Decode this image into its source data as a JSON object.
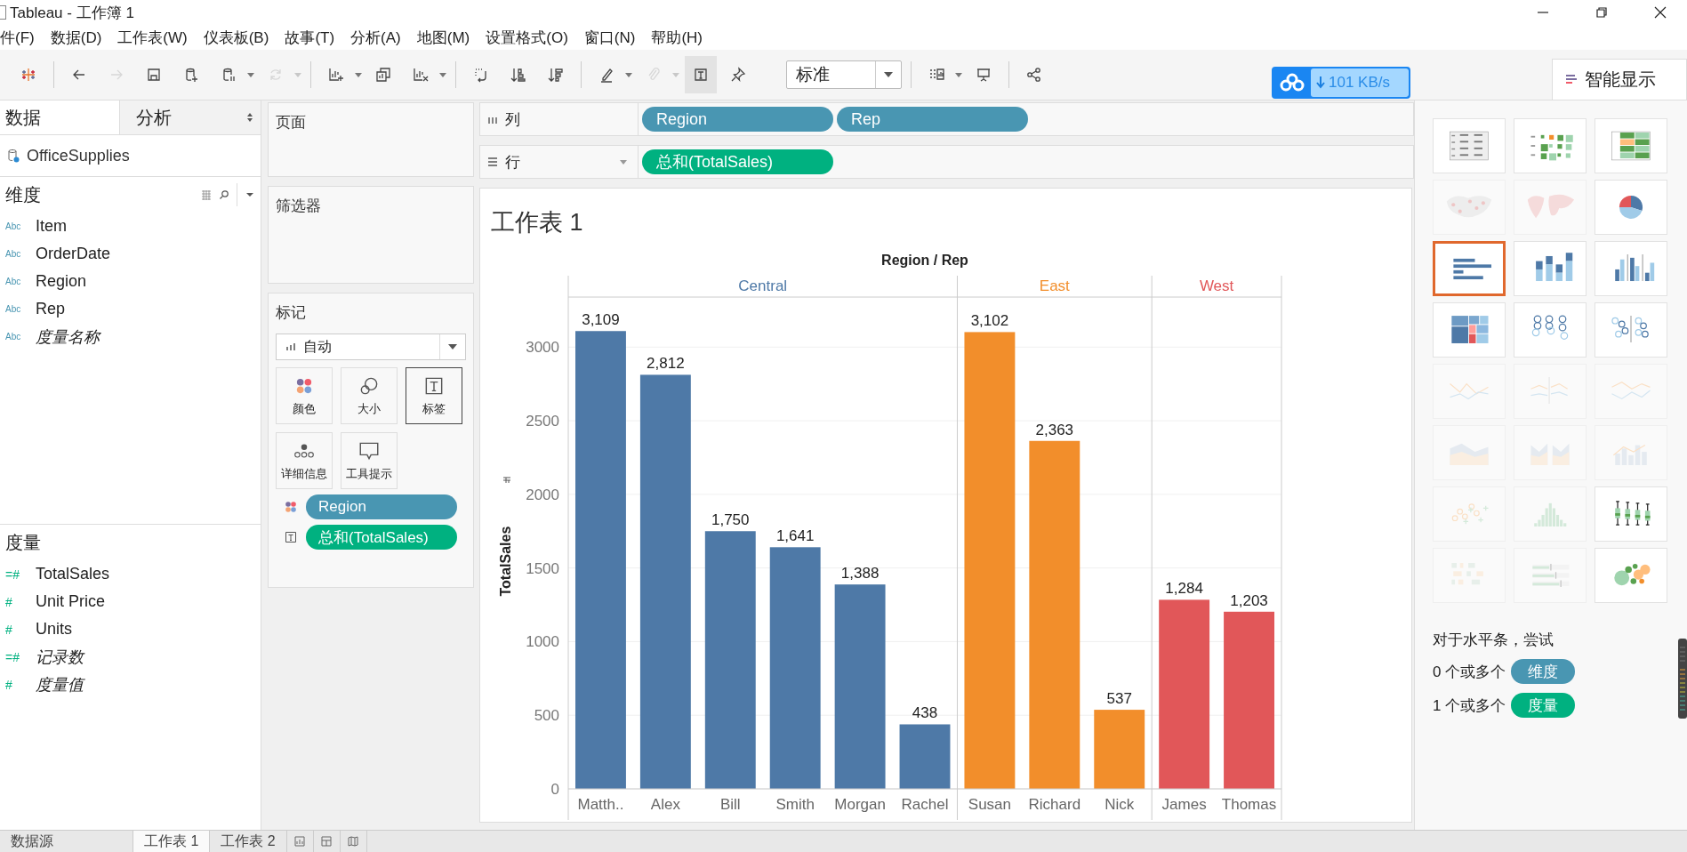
{
  "window": {
    "title": "Tableau - 工作簿 1"
  },
  "menu": [
    "件(F)",
    "数据(D)",
    "工作表(W)",
    "仪表板(B)",
    "故事(T)",
    "分析(A)",
    "地图(M)",
    "设置格式(O)",
    "窗口(N)",
    "帮助(H)"
  ],
  "toolbar": [
    [
      {
        "kind": "logo",
        "disabled": false,
        "pressed": false,
        "caret": false
      }
    ],
    [
      {
        "kind": "back",
        "disabled": false,
        "pressed": false,
        "caret": false
      },
      {
        "kind": "forward",
        "disabled": true,
        "pressed": false,
        "caret": false
      },
      {
        "kind": "save",
        "disabled": false,
        "pressed": false,
        "caret": false
      },
      {
        "kind": "add-datasource",
        "disabled": false,
        "pressed": false,
        "caret": false
      },
      {
        "kind": "pause-datasource",
        "disabled": false,
        "pressed": false,
        "caret": true
      },
      {
        "kind": "refresh",
        "disabled": true,
        "pressed": false,
        "caret": true
      }
    ],
    [
      {
        "kind": "new-sheet",
        "disabled": false,
        "pressed": false,
        "caret": true
      },
      {
        "kind": "duplicate",
        "disabled": false,
        "pressed": false,
        "caret": false
      },
      {
        "kind": "clear-sheet",
        "disabled": false,
        "pressed": false,
        "caret": true
      }
    ],
    [
      {
        "kind": "swap",
        "disabled": false,
        "pressed": false,
        "caret": false
      },
      {
        "kind": "sort-ascending",
        "disabled": false,
        "pressed": false,
        "caret": false
      },
      {
        "kind": "sort-descending",
        "disabled": false,
        "pressed": false,
        "caret": false
      }
    ],
    [
      {
        "kind": "highlight",
        "disabled": false,
        "pressed": false,
        "caret": true
      },
      {
        "kind": "paperclip",
        "disabled": true,
        "pressed": false,
        "caret": true
      },
      {
        "kind": "labels",
        "disabled": false,
        "pressed": true,
        "caret": false
      },
      {
        "kind": "pin",
        "disabled": false,
        "pressed": false,
        "caret": false
      },
      {
        "kind": "select",
        "value": "标准"
      }
    ],
    [
      {
        "kind": "cards",
        "disabled": false,
        "pressed": false,
        "caret": true
      },
      {
        "kind": "presentation",
        "disabled": false,
        "pressed": false,
        "caret": false
      }
    ],
    [
      {
        "kind": "share",
        "disabled": false,
        "pressed": false,
        "caret": false
      }
    ]
  ],
  "download_badge": {
    "speed": "101 KB/s"
  },
  "data_pane": {
    "tabs": [
      {
        "label": "数据",
        "selected": true
      },
      {
        "label": "分析",
        "selected": false
      }
    ],
    "datasource": "OfficeSupplies",
    "dimensions": {
      "title": "维度",
      "fields": [
        {
          "type": "Abc",
          "name": "Item",
          "generated": false
        },
        {
          "type": "Abc",
          "name": "OrderDate",
          "generated": false
        },
        {
          "type": "Abc",
          "name": "Region",
          "generated": false
        },
        {
          "type": "Abc",
          "name": "Rep",
          "generated": false
        },
        {
          "type": "Abc",
          "name": "度量名称",
          "generated": true
        }
      ]
    },
    "measures": {
      "title": "度量",
      "fields": [
        {
          "type": "=#",
          "name": "TotalSales",
          "generated": false
        },
        {
          "type": "#",
          "name": "Unit Price",
          "generated": false
        },
        {
          "type": "#",
          "name": "Units",
          "generated": false
        },
        {
          "type": "=#",
          "name": "记录数",
          "generated": true
        },
        {
          "type": "#",
          "name": "度量值",
          "generated": true
        }
      ]
    }
  },
  "shelves": {
    "pages": "页面",
    "filters": "筛选器",
    "marks": {
      "title": "标记",
      "mark_type": "自动",
      "cards": [
        {
          "label": "颜色",
          "kind": "color",
          "selected": false
        },
        {
          "label": "大小",
          "kind": "size",
          "selected": false
        },
        {
          "label": "标签",
          "kind": "label",
          "selected": true
        },
        {
          "label": "详细信息",
          "kind": "detail",
          "selected": false
        },
        {
          "label": "工具提示",
          "kind": "tooltip",
          "selected": false
        }
      ],
      "pills": [
        {
          "kind": "color",
          "label": "Region",
          "color": "#4996b2"
        },
        {
          "kind": "label",
          "label": "总和(TotalSales)",
          "color": "#00b180"
        }
      ]
    }
  },
  "columns": {
    "label": "列",
    "pills": [
      {
        "label": "Region",
        "color": "#4996b2"
      },
      {
        "label": "Rep",
        "color": "#4996b2"
      }
    ]
  },
  "rows": {
    "label": "行",
    "pills": [
      {
        "label": "总和(TotalSales)",
        "color": "#00b180"
      }
    ]
  },
  "sheet": {
    "title": "工作表 1",
    "chart_data": {
      "type": "bar",
      "xlabel": "Region / Rep",
      "ylabel": "TotalSales",
      "categories": [
        "Matth..",
        "Alex",
        "Bill",
        "Smith",
        "Morgan",
        "Rachel",
        "Susan",
        "Richard",
        "Nick",
        "James",
        "Thomas"
      ],
      "series": [
        {
          "name": "Central",
          "color": "#4e79a7",
          "values": [
            3109,
            2812,
            1750,
            1641,
            1388,
            438,
            null,
            null,
            null,
            null,
            null
          ],
          "value_labels": [
            "3,109",
            "2,812",
            "1,750",
            "1,641",
            "1,388",
            "438",
            null,
            null,
            null,
            null,
            null
          ]
        },
        {
          "name": "East",
          "color": "#f28e2b",
          "values": [
            null,
            null,
            null,
            null,
            null,
            null,
            3102,
            2363,
            537,
            null,
            null
          ],
          "value_labels": [
            null,
            null,
            null,
            null,
            null,
            null,
            "3,102",
            "2,363",
            "537",
            null,
            null
          ]
        },
        {
          "name": "West",
          "color": "#e15759",
          "values": [
            null,
            null,
            null,
            null,
            null,
            null,
            null,
            null,
            null,
            1284,
            1203
          ],
          "value_labels": [
            null,
            null,
            null,
            null,
            null,
            null,
            null,
            null,
            null,
            "1,284",
            "1,203"
          ]
        }
      ],
      "ylim": [
        0,
        3340
      ],
      "yticks": [
        0,
        500,
        1000,
        1500,
        2000,
        2500,
        3000
      ],
      "stacked": true,
      "grid": true
    }
  },
  "show_me": {
    "tab": "智能显示",
    "charts": [
      {
        "kind": "text-table",
        "selected": false,
        "disabled": false
      },
      {
        "kind": "heat-map",
        "selected": false,
        "disabled": false
      },
      {
        "kind": "highlight-table",
        "selected": false,
        "disabled": false
      },
      {
        "kind": "symbol-map",
        "selected": false,
        "disabled": true
      },
      {
        "kind": "filled-map",
        "selected": false,
        "disabled": true
      },
      {
        "kind": "pie-chart",
        "selected": false,
        "disabled": false
      },
      {
        "kind": "horizontal-bars",
        "selected": true,
        "disabled": false
      },
      {
        "kind": "stacked-bars",
        "selected": false,
        "disabled": false
      },
      {
        "kind": "side-by-side-bars",
        "selected": false,
        "disabled": false
      },
      {
        "kind": "treemap",
        "selected": false,
        "disabled": false
      },
      {
        "kind": "circle-view",
        "selected": false,
        "disabled": false
      },
      {
        "kind": "side-by-side-circles",
        "selected": false,
        "disabled": false
      },
      {
        "kind": "continuous-lines",
        "selected": false,
        "disabled": true
      },
      {
        "kind": "discrete-lines",
        "selected": false,
        "disabled": true
      },
      {
        "kind": "dual-lines",
        "selected": false,
        "disabled": true
      },
      {
        "kind": "continuous-area",
        "selected": false,
        "disabled": true
      },
      {
        "kind": "discrete-area",
        "selected": false,
        "disabled": true
      },
      {
        "kind": "dual-combination",
        "selected": false,
        "disabled": true
      },
      {
        "kind": "scatter-plot",
        "selected": false,
        "disabled": true
      },
      {
        "kind": "histogram",
        "selected": false,
        "disabled": true
      },
      {
        "kind": "box-plot",
        "selected": false,
        "disabled": false
      },
      {
        "kind": "gantt-chart",
        "selected": false,
        "disabled": true
      },
      {
        "kind": "bullet-graph",
        "selected": false,
        "disabled": true
      },
      {
        "kind": "packed-bubbles",
        "selected": false,
        "disabled": false
      }
    ],
    "hint": "对于水平条，尝试",
    "requirements": [
      {
        "count": "0 个或多个",
        "pill": "维度",
        "color": "#4996b2"
      },
      {
        "count": "1 个或多个",
        "pill": "度量",
        "color": "#00b180"
      }
    ]
  },
  "bottom_tabs": [
    {
      "label": "数据源",
      "selected": false
    },
    {
      "label": "工作表 1",
      "selected": true
    },
    {
      "label": "工作表 2",
      "selected": false
    }
  ]
}
